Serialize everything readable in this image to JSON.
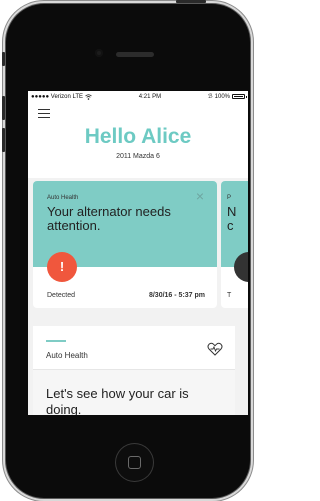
{
  "status_bar": {
    "carrier": "●●●●● Verizon LTE",
    "wifi_icon": "wifi-icon",
    "time": "4:21 PM",
    "bluetooth": "ℬ",
    "battery_text": "100%"
  },
  "header": {
    "menu_icon": "hamburger-menu-icon",
    "greeting": "Hello Alice",
    "car": "2011 Mazda 6"
  },
  "alert_card": {
    "kicker": "Auto Health",
    "close": "×",
    "message": "Your alternator needs attention.",
    "alert_symbol": "!",
    "status_label": "Detected",
    "date": "8/30/16 - 5:37 pm",
    "accent_color": "#7fccc5",
    "alert_color": "#f0573d"
  },
  "next_card": {
    "kicker": "P",
    "message_line1": "N",
    "message_line2": "c",
    "foot": "T"
  },
  "health_panel": {
    "title": "Auto Health",
    "icon": "heart-pulse-icon",
    "message": "Let's see how your car is doing."
  }
}
